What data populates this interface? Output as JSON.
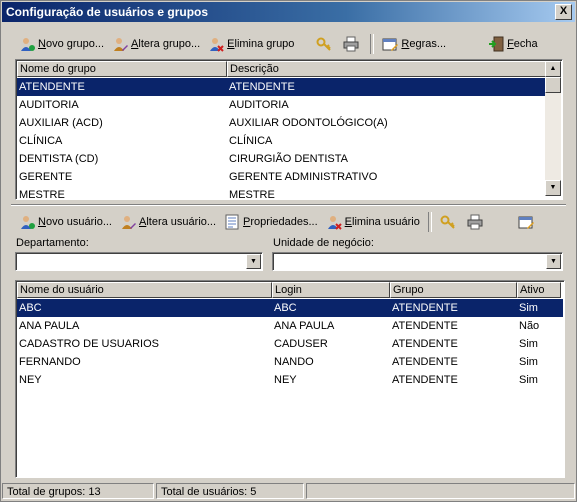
{
  "window": {
    "title": "Configuração de usuários e grupos",
    "close_label": "X"
  },
  "groups_toolbar": {
    "new": "Novo grupo...",
    "edit": "Altera grupo...",
    "delete": "Elimina grupo",
    "rules": "Regras...",
    "close": "Fecha"
  },
  "groups_table": {
    "columns": [
      "Nome do grupo",
      "Descrição"
    ],
    "rows": [
      [
        "ATENDENTE",
        "ATENDENTE"
      ],
      [
        "AUDITORIA",
        "AUDITORIA"
      ],
      [
        "AUXILIAR (ACD)",
        "AUXILIAR ODONTOLÓGICO(A)"
      ],
      [
        "CLÍNICA",
        "CLÍNICA"
      ],
      [
        "DENTISTA (CD)",
        "CIRURGIÃO DENTISTA"
      ],
      [
        "GERENTE",
        "GERENTE ADMINISTRATIVO"
      ],
      [
        "MESTRE",
        "MESTRE"
      ]
    ],
    "selected_index": 0
  },
  "users_toolbar": {
    "new": "Novo usuário...",
    "edit": "Altera usuário...",
    "properties": "Propriedades...",
    "delete": "Elimina usuário"
  },
  "filters": {
    "department_label": "Departamento:",
    "department_value": "",
    "business_unit_label": "Unidade de negócio:",
    "business_unit_value": ""
  },
  "users_table": {
    "columns": [
      "Nome do usuário",
      "Login",
      "Grupo",
      "Ativo"
    ],
    "rows": [
      [
        "ABC",
        "ABC",
        "ATENDENTE",
        "Sim"
      ],
      [
        "ANA PAULA",
        "ANA PAULA",
        "ATENDENTE",
        "Não"
      ],
      [
        "CADASTRO DE USUARIOS",
        "CADUSER",
        "ATENDENTE",
        "Sim"
      ],
      [
        "FERNANDO",
        "NANDO",
        "ATENDENTE",
        "Sim"
      ],
      [
        "NEY",
        "NEY",
        "ATENDENTE",
        "Sim"
      ]
    ],
    "selected_index": 0
  },
  "status": {
    "groups_total": "Total de grupos: 13",
    "users_total": "Total de usuários: 5",
    "extra": ""
  },
  "colors": {
    "selection": "#0a246a",
    "titlebar_start": "#0a246a",
    "face": "#d4d0c8"
  },
  "icons": [
    "user-add-icon",
    "user-edit-icon",
    "user-delete-icon",
    "key-icon",
    "printer-icon",
    "rules-icon",
    "exit-icon",
    "properties-icon",
    "scroll-up-icon",
    "scroll-down-icon",
    "dropdown-arrow-icon"
  ]
}
